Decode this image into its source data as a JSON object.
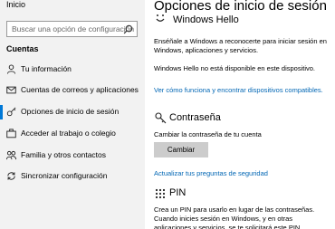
{
  "sidebar": {
    "top_label": "Inicio",
    "search_placeholder": "Buscar una opción de configuración",
    "section_heading": "Cuentas",
    "items": [
      {
        "label": "Tu información",
        "icon": "person-icon"
      },
      {
        "label": "Cuentas de correos y aplicaciones",
        "icon": "mail-icon"
      },
      {
        "label": "Opciones de inicio de sesión",
        "icon": "key-icon",
        "active": true
      },
      {
        "label": "Acceder al trabajo o colegio",
        "icon": "briefcase-icon"
      },
      {
        "label": "Familia y otros contactos",
        "icon": "family-icon"
      },
      {
        "label": "Sincronizar configuración",
        "icon": "sync-icon"
      }
    ]
  },
  "main": {
    "title": "Opciones de inicio de sesión",
    "hello": {
      "heading": "Windows Hello",
      "description": "Enséñale a Windows a reconocerte para iniciar sesión en Windows, aplicaciones y servicios.",
      "status": "Windows Hello no está disponible en este dispositivo.",
      "link": "Ver cómo funciona y encontrar dispositivos compatibles."
    },
    "password": {
      "heading": "Contraseña",
      "description": "Cambiar la contraseña de tu cuenta",
      "button": "Cambiar",
      "link": "Actualizar tus preguntas de seguridad"
    },
    "pin": {
      "heading": "PIN",
      "description": "Crea un PIN para usarlo en lugar de las contraseñas. Cuando inicies sesión en Windows, y en otras aplicaciones y servicios, se te solicitará este PIN."
    }
  },
  "colors": {
    "accent": "#0078d7",
    "link": "#0066b4",
    "sidebar_bg": "#f2f2f2"
  }
}
